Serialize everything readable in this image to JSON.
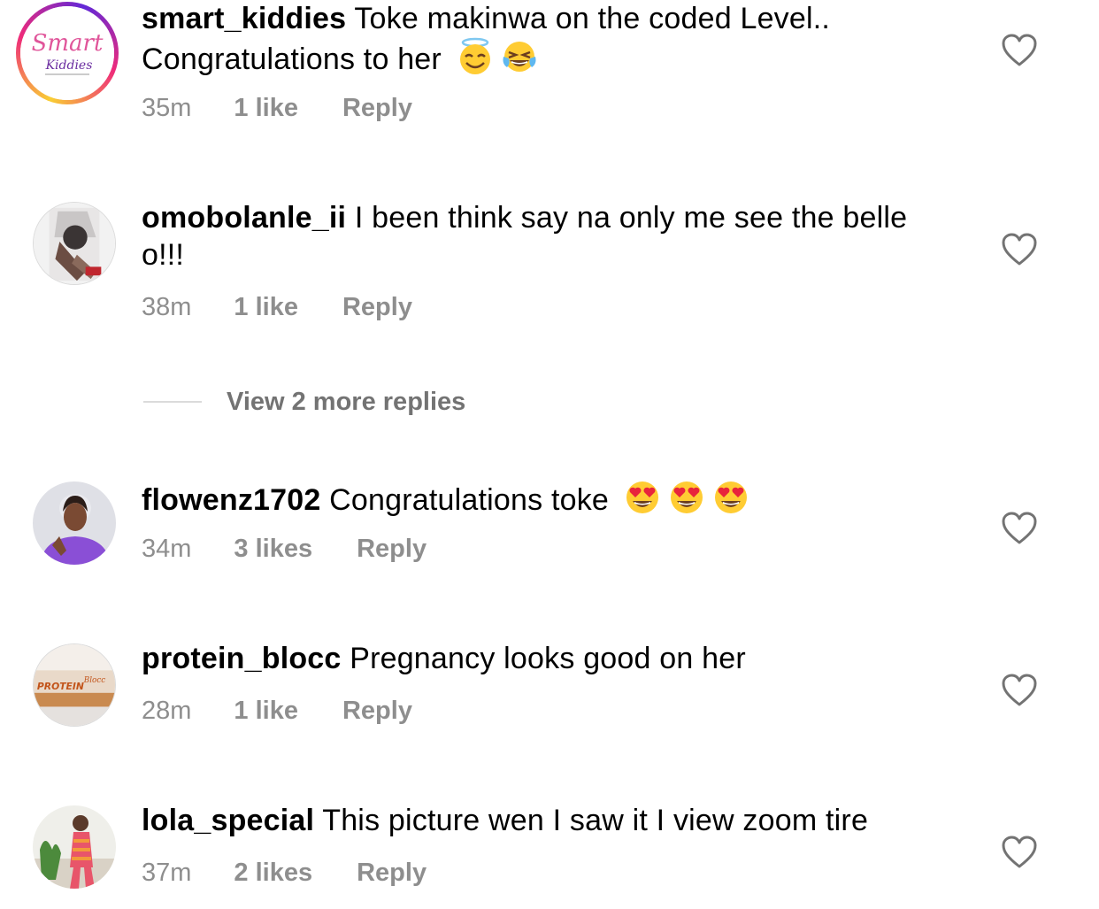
{
  "comments": [
    {
      "username": "smart_kiddies",
      "text": "Toke makinwa on the coded Level.. Congratulations to her",
      "emojis": [
        "smiling-face-with-halo",
        "face-with-tears-of-joy"
      ],
      "time": "35m",
      "likes": "1 like",
      "reply": "Reply",
      "avatar_logo_main": "Smart",
      "avatar_logo_sub": "Kiddies"
    },
    {
      "username": "omobolanle_ii",
      "text": "I been think say na only me see the belle o!!!",
      "emojis": [],
      "time": "38m",
      "likes": "1 like",
      "reply": "Reply"
    },
    {
      "username": "flowenz1702",
      "text": "Congratulations toke",
      "emojis": [
        "smiling-face-with-heart-eyes",
        "smiling-face-with-heart-eyes",
        "smiling-face-with-heart-eyes"
      ],
      "time": "34m",
      "likes": "3 likes",
      "reply": "Reply"
    },
    {
      "username": "protein_blocc",
      "text": "Pregnancy looks good on her",
      "emojis": [],
      "time": "28m",
      "likes": "1 like",
      "reply": "Reply",
      "avatar_logo_main": "PROTEIN",
      "avatar_logo_sub": "Blocc"
    },
    {
      "username": "lola_special",
      "text": "This picture wen I saw it I view zoom tire",
      "emojis": [],
      "time": "37m",
      "likes": "2 likes",
      "reply": "Reply"
    }
  ],
  "view_more_replies": "View 2 more replies",
  "colors": {
    "meta_text": "#8e8e8e",
    "divider": "#dbdbdb",
    "heart_outline": "#737373",
    "story_ring": [
      "#f9ce34",
      "#ee2a7b",
      "#6228d7"
    ]
  },
  "icons": {
    "like": "heart-outline-icon"
  }
}
